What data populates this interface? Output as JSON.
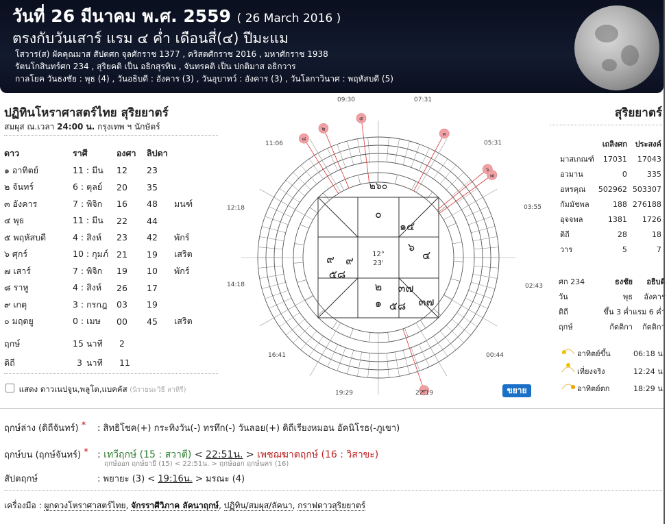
{
  "header": {
    "title_main": "วันที่ 26 มีนาคม พ.ศ. 2559",
    "title_en": "( 26 March 2016 )",
    "line2": "ตรงกับวันเสาร์ แรม ๔ ค่ำ เดือนสี่(๔) ปีมะแม",
    "line3": "โสวาร(ส) ผัคคุณมาส สัปตศก จุลศักราช 1377 , คริสตศักราช 2016 , มหาศักราช 1938",
    "line4": "รัตนโกสินทร์ศก 234 , สุริยคติ เป็น อธิกสุรทิน , จันทรคติ เป็น ปกติมาส อธิกวาร",
    "line5": "กาลโยค วันธงชัย : พุธ (4) , วันอธิบดี : อังคาร (3) , วันอุบาทว์ : อังคาร (3) , วันโลกาวินาศ : พฤหัสบดี (5)"
  },
  "left": {
    "title": "ปฏิทินโหราศาสตร์ไทย สุริยยาตร์",
    "subtitle_pre": "สมผุส ณ.เวลา",
    "subtitle_time": "24:00 น.",
    "subtitle_post": "กรุงเทพ ฯ นักษัตร์",
    "columns": [
      "ดาว",
      "ราศี",
      "องศา",
      "ลิปดา"
    ],
    "planets": [
      {
        "name": "๑ อาทิตย์",
        "rasi": "11 : มีน",
        "deg": "12",
        "min": "23",
        "note": ""
      },
      {
        "name": "๒ จันทร์",
        "rasi": "6 : ตุลย์",
        "deg": "20",
        "min": "35",
        "note": ""
      },
      {
        "name": "๓ อังคาร",
        "rasi": "7 : พิจิก",
        "deg": "16",
        "min": "48",
        "note": "มนฑ์"
      },
      {
        "name": "๔ พุธ",
        "rasi": "11 : มีน",
        "deg": "22",
        "min": "44",
        "note": ""
      },
      {
        "name": "๕ พฤหัสบดี",
        "rasi": "4 : สิงห์",
        "deg": "23",
        "min": "42",
        "note": "พักร์"
      },
      {
        "name": "๖ ศุกร์",
        "rasi": "10 : กุมภ์",
        "deg": "21",
        "min": "19",
        "note": "เสริต"
      },
      {
        "name": "๗ เสาร์",
        "rasi": "7 : พิจิก",
        "deg": "19",
        "min": "10",
        "note": "พักร์"
      },
      {
        "name": "๘ ราหู",
        "rasi": "4 : สิงห์",
        "deg": "26",
        "min": "17",
        "note": ""
      },
      {
        "name": "๙ เกตุ",
        "rasi": "3 : กรกฎ",
        "deg": "03",
        "min": "19",
        "note": ""
      },
      {
        "name": "๐ มฤตยู",
        "rasi": "0 : เมษ",
        "deg": "00",
        "min": "45",
        "note": "เสริต"
      }
    ],
    "lerk_label": "ฤกษ์",
    "lerk_val": "15",
    "lerk_unit": "นาที",
    "lerk_min": "2",
    "diti_label": "ดิถี",
    "diti_val": "3",
    "diti_unit": "นาที",
    "diti_min": "11",
    "checkbox_label": "แสดง ดาวเนปจูน,พลูโต,แบคคัส",
    "checkbox_note": "(นิรายนะวิธี ลาหิรี)"
  },
  "wheel": {
    "times": [
      "09:30",
      "07:31",
      "05:31",
      "03:55",
      "02:43",
      "00:44",
      "22:19",
      "19:29",
      "16:41",
      "14:18",
      "12:18",
      "11:06"
    ],
    "center_deg": "12°",
    "center_min": "23'",
    "house_numerals": [
      "๐",
      "๑๔",
      "๖",
      "๔",
      "๓๗",
      "๓๗",
      "๕๘",
      "๑",
      "๒",
      "๕๘",
      "๙",
      "๙"
    ],
    "outer_numeral": "๒๖๐",
    "pin_labels": [
      "๘",
      "๕",
      "๖",
      "๗",
      "๙",
      "๓",
      "๒"
    ],
    "zoom_label": "ขยาย"
  },
  "right": {
    "title": "สุริยยาตร์",
    "col1": "เถลิงศก",
    "col2": "ประสงค์",
    "rows": [
      {
        "label": "มาสเกณฑ์",
        "a": "17031",
        "b": "17043"
      },
      {
        "label": "อวมาน",
        "a": "0",
        "b": "335"
      },
      {
        "label": "อหรคุณ",
        "a": "502962",
        "b": "503307"
      },
      {
        "label": "กัมมัชพล",
        "a": "188",
        "b": "276188"
      },
      {
        "label": "อุจจพล",
        "a": "1381",
        "b": "1726"
      },
      {
        "label": "ดิถี",
        "a": "28",
        "b": "18"
      },
      {
        "label": "วาร",
        "a": "5",
        "b": "7"
      }
    ],
    "sok": "ศก 234",
    "h_thongchai": "ธงชัย",
    "h_athibodi": "อธิบดี",
    "rows2": [
      {
        "label": "วัน",
        "a": "พุธ",
        "b": "อังคาร"
      },
      {
        "label": "ดิถี",
        "a": "ขึ้น 3 ค่ำ",
        "b": "แรม 6 ค่ำ"
      },
      {
        "label": "ฤกษ์",
        "a": "กัตติกา",
        "b": "กัตติกา"
      }
    ],
    "sunrise_label": "อาทิตย์ขึ้น",
    "sunrise_time": "06:18 น.",
    "noon_label": "เที่ยงจริง",
    "noon_time": "12:24 น.",
    "sunset_label": "อาทิตย์ตก",
    "sunset_time": "18:29 น."
  },
  "bottom": {
    "r1_label": "ฤกษ์ล่าง (ดิถีจันทร์)",
    "r1_val": ": สิทธิโชค(+) กระทิงวัน(-) ทรทึก(-) วันลอย(+) ดิถีเรียงหมอน อัคนิโรธ(-ภูเขา)",
    "r2_label": "ฤกษ์บน (ฤกษ์จันทร์)",
    "r2_colon": ":",
    "r2_a": "เทวีฤกษ์ (15 : สวาตี)",
    "r2_lt": "<",
    "r2_time": "22:51น.",
    "r2_gt": ">",
    "r2_b": "เพชฌฆาตฤกษ์ (16 : วิสาขะ)",
    "r2_small": "ฤกษ์ออก ฤกษ์ยายี (15) < 22:51น. > ฤกษ์ออก ฤกษ์นคร (16)",
    "r3_label": "สัปตฤกษ์",
    "r3_pre": ": พยายะ (3) <",
    "r3_time": "19:16น.",
    "r3_post": "> มรณะ (4)",
    "tools_label": "เครื่องมือ :",
    "tool1": "ผูกดวงโหราศาสตร์ไทย",
    "tool2": "จักรราศีวิภาค ลัคนาฤกษ์",
    "tool3": "ปฏิทิน/สมผุส/ลัคนา",
    "tool4": "กราฟดาวสุริยยาตร์",
    "star": "*"
  }
}
